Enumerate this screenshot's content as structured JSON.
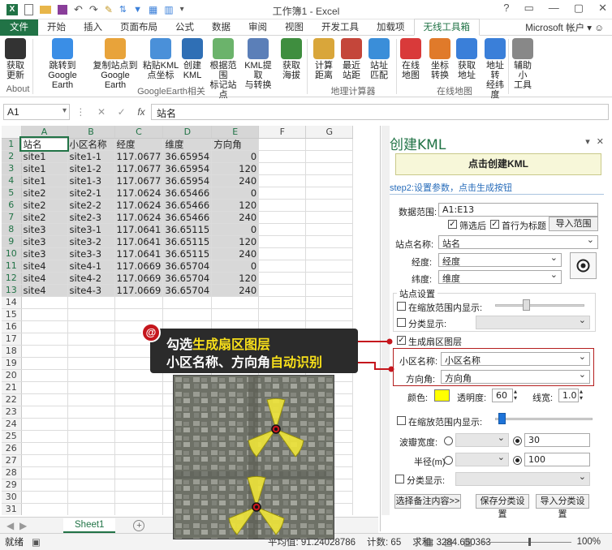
{
  "window": {
    "title": "工作簿1 - Excel",
    "controls": [
      "?",
      "▭",
      "—",
      "▢",
      "✕"
    ]
  },
  "ribbon_tabs": {
    "file": "文件",
    "items": [
      "开始",
      "插入",
      "页面布局",
      "公式",
      "数据",
      "审阅",
      "视图",
      "开发工具",
      "加载项"
    ],
    "active": "无线工具箱",
    "account": "Microsoft 帐户"
  },
  "ribbon": {
    "buttons": [
      {
        "label": "获取\n更新",
        "color": "#333333"
      },
      {
        "label": "跳转到\nGoogle Earth",
        "color": "#3a8ee6"
      },
      {
        "label": "复制站点到\nGoogle Earth",
        "color": "#e8a33a"
      },
      {
        "label": "粘贴KML\n点坐标",
        "color": "#4a90d9"
      },
      {
        "label": "创建\nKML",
        "color": "#2f6fb5"
      },
      {
        "label": "根据范围\n标记站点",
        "color": "#6bb36b"
      },
      {
        "label": "KML提取\n与转换",
        "color": "#5b7fb8"
      },
      {
        "label": "获取\n海拔",
        "color": "#3f8e3f"
      },
      {
        "label": "计算\n距离",
        "color": "#d9a63a"
      },
      {
        "label": "最近\n站距",
        "color": "#c4463a"
      },
      {
        "label": "站址\n匹配",
        "color": "#3a8ed9"
      },
      {
        "label": "在线\n地图",
        "color": "#d93a3a"
      },
      {
        "label": "坐标\n转换",
        "color": "#e07a2a"
      },
      {
        "label": "获取\n地址",
        "color": "#3a7fd9"
      },
      {
        "label": "地址转\n经纬度",
        "color": "#3a7fd9"
      },
      {
        "label": "辅助小\n工具",
        "color": "#888888"
      }
    ],
    "groups": [
      "About",
      "GoogleEarth相关",
      "地理计算器",
      "在线地图"
    ]
  },
  "formula_bar": {
    "name_box": "A1",
    "fx_icons": [
      "⋮",
      "✕",
      "✓",
      "fx"
    ],
    "formula": "站名"
  },
  "sheet": {
    "columns": [
      "A",
      "B",
      "C",
      "D",
      "E",
      "F",
      "G"
    ],
    "header_row": [
      "站名",
      "小区名称",
      "经度",
      "维度",
      "方向角"
    ],
    "rows": [
      [
        "site1",
        "site1-1",
        "117.0677",
        "36.65954",
        "0"
      ],
      [
        "site1",
        "site1-2",
        "117.0677",
        "36.65954",
        "120"
      ],
      [
        "site1",
        "site1-3",
        "117.0677",
        "36.65954",
        "240"
      ],
      [
        "site2",
        "site2-1",
        "117.0624",
        "36.65466",
        "0"
      ],
      [
        "site2",
        "site2-2",
        "117.0624",
        "36.65466",
        "120"
      ],
      [
        "site2",
        "site2-3",
        "117.0624",
        "36.65466",
        "240"
      ],
      [
        "site3",
        "site3-1",
        "117.0641",
        "36.65115",
        "0"
      ],
      [
        "site3",
        "site3-2",
        "117.0641",
        "36.65115",
        "120"
      ],
      [
        "site3",
        "site3-3",
        "117.0641",
        "36.65115",
        "240"
      ],
      [
        "site4",
        "site4-1",
        "117.0669",
        "36.65704",
        "0"
      ],
      [
        "site4",
        "site4-2",
        "117.0669",
        "36.65704",
        "120"
      ],
      [
        "site4",
        "site4-3",
        "117.0669",
        "36.65704",
        "240"
      ]
    ],
    "row_count": 31,
    "tab_name": "Sheet1",
    "add_sheet": "+"
  },
  "status": {
    "ready": "就绪",
    "avg": "平均值: 91.24028786",
    "count": "计数: 65",
    "sum": "求和: 3284.650363",
    "zoom": "100%"
  },
  "pane": {
    "title": "创建KML",
    "controls": [
      "▾",
      "✕"
    ],
    "create_button": "点击创建KML",
    "step2": "step2:设置参数，点击生成按钮",
    "data_range_label": "数据范围:",
    "data_range_value": "A1:E13",
    "filter_label": "筛选后",
    "header_label": "首行为标题",
    "import_range": "导入范围",
    "site_name_label": "站点名称:",
    "site_name_value": "站名",
    "lon_label": "经度:",
    "lon_value": "经度",
    "lat_label": "纬度:",
    "lat_value": "维度",
    "site_settings": "站点设置",
    "show_in_range": "在缩放范围内显示:",
    "category_show": "分类显示:",
    "gen_sector": "生成扇区图层",
    "cell_name_label": "小区名称:",
    "cell_name_value": "小区名称",
    "azimuth_label": "方向角:",
    "azimuth_value": "方向角",
    "color_label": "颜色:",
    "color_value": "#ffff00",
    "opacity_label": "透明度:",
    "opacity_value": "60",
    "linewidth_label": "线宽:",
    "linewidth_value": "1.0",
    "show_in_range2": "在缩放范围内显示:",
    "beam_label": "波瓣宽度:",
    "beam_value": "30",
    "radius_label": "半径(m)",
    "radius_value": "100",
    "category_show2": "分类显示:",
    "btn_note": "选择备注内容>>",
    "btn_save": "保存分类设置",
    "btn_import": "导入分类设置"
  },
  "callout": {
    "badge": "@",
    "line1_a": "勾选",
    "line1_b": "生成扇区图层",
    "line2_a": "小区名称、方向角",
    "line2_b": "自动识别"
  }
}
